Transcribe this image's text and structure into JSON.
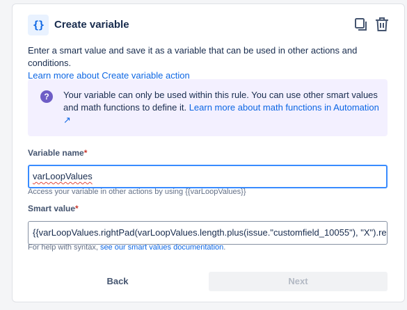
{
  "header": {
    "icon_glyph": "{}",
    "title": "Create variable",
    "copy_icon": "copy-icon",
    "delete_icon": "trash-icon"
  },
  "description": {
    "text": "Enter a smart value and save it as a variable that can be used in other actions and conditions.",
    "link": "Learn more about Create variable action"
  },
  "info": {
    "icon": "question-circle-icon",
    "text": "Your variable can only be used within this rule. You can use other smart values and math functions to define it.",
    "link": "Learn more about math functions in Automation ↗"
  },
  "variable_name": {
    "label": "Variable name",
    "required_mark": "*",
    "value": "varLoopValues",
    "help": "Access your variable in other actions by using {{varLoopValues}}"
  },
  "smart_value": {
    "label": "Smart value",
    "required_mark": "*",
    "value": "{{varLoopValues.rightPad(varLoopValues.length.plus(issue.\"customfield_10055\"), \"X\").remove",
    "help_prefix": "For help with syntax,",
    "help_link": "see our smart values documentation",
    "help_suffix": "."
  },
  "buttons": {
    "back": "Back",
    "next": "Next"
  },
  "colors": {
    "accent": "#0c66e4",
    "info_bg": "#f3f0ff",
    "info_icon": "#6e5dc6",
    "focus_border": "#388bff",
    "required": "#c9372c"
  }
}
